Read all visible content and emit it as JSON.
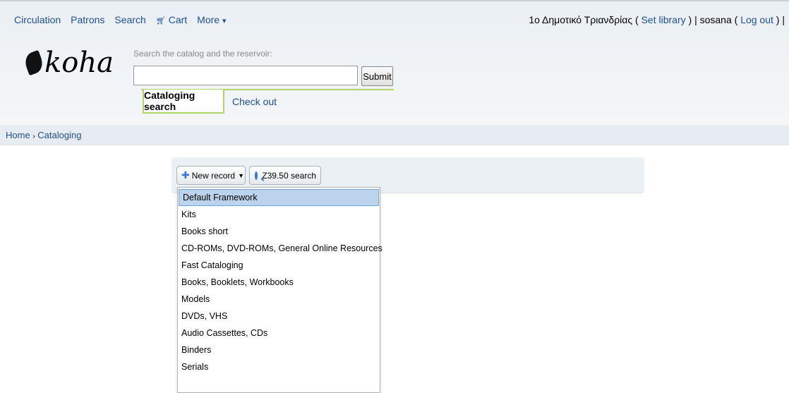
{
  "topnav": {
    "items": [
      "Circulation",
      "Patrons",
      "Search"
    ],
    "cart_label": "Cart",
    "more_label": "More",
    "more_icon": "▾",
    "cart_icon": "cart-icon"
  },
  "login": {
    "library": "1ο Δημοτικό Τριανδρίας",
    "open_paren": "(",
    "set_library": "Set library",
    "close_pipe": ") | sosana (",
    "log_out": "Log out",
    "end": ") |"
  },
  "logo": {
    "text": "koha"
  },
  "search": {
    "label": "Search the catalog and the reservoir:",
    "value": "",
    "submit": "Submit"
  },
  "tabs": {
    "active": "Cataloging search",
    "checkout": "Check out"
  },
  "breadcrumb": {
    "home": "Home",
    "separator": "›",
    "current": "Cataloging"
  },
  "toolbar": {
    "new_record": "New record",
    "z3950": "Z39.50 search"
  },
  "menu": {
    "items": [
      "Default Framework",
      "Kits",
      "Books short",
      "CD-ROMs, DVD-ROMs, General Online Resources",
      "Fast Cataloging",
      "Books, Booklets, Workbooks",
      "Models",
      "DVDs, VHS",
      "Audio Cassettes, CDs",
      "Binders",
      "Serials"
    ],
    "selected_index": 0
  },
  "colors": {
    "link": "#1f4f8f",
    "tab_border": "#b0d36a",
    "selected_bg": "#bcd3ee"
  }
}
